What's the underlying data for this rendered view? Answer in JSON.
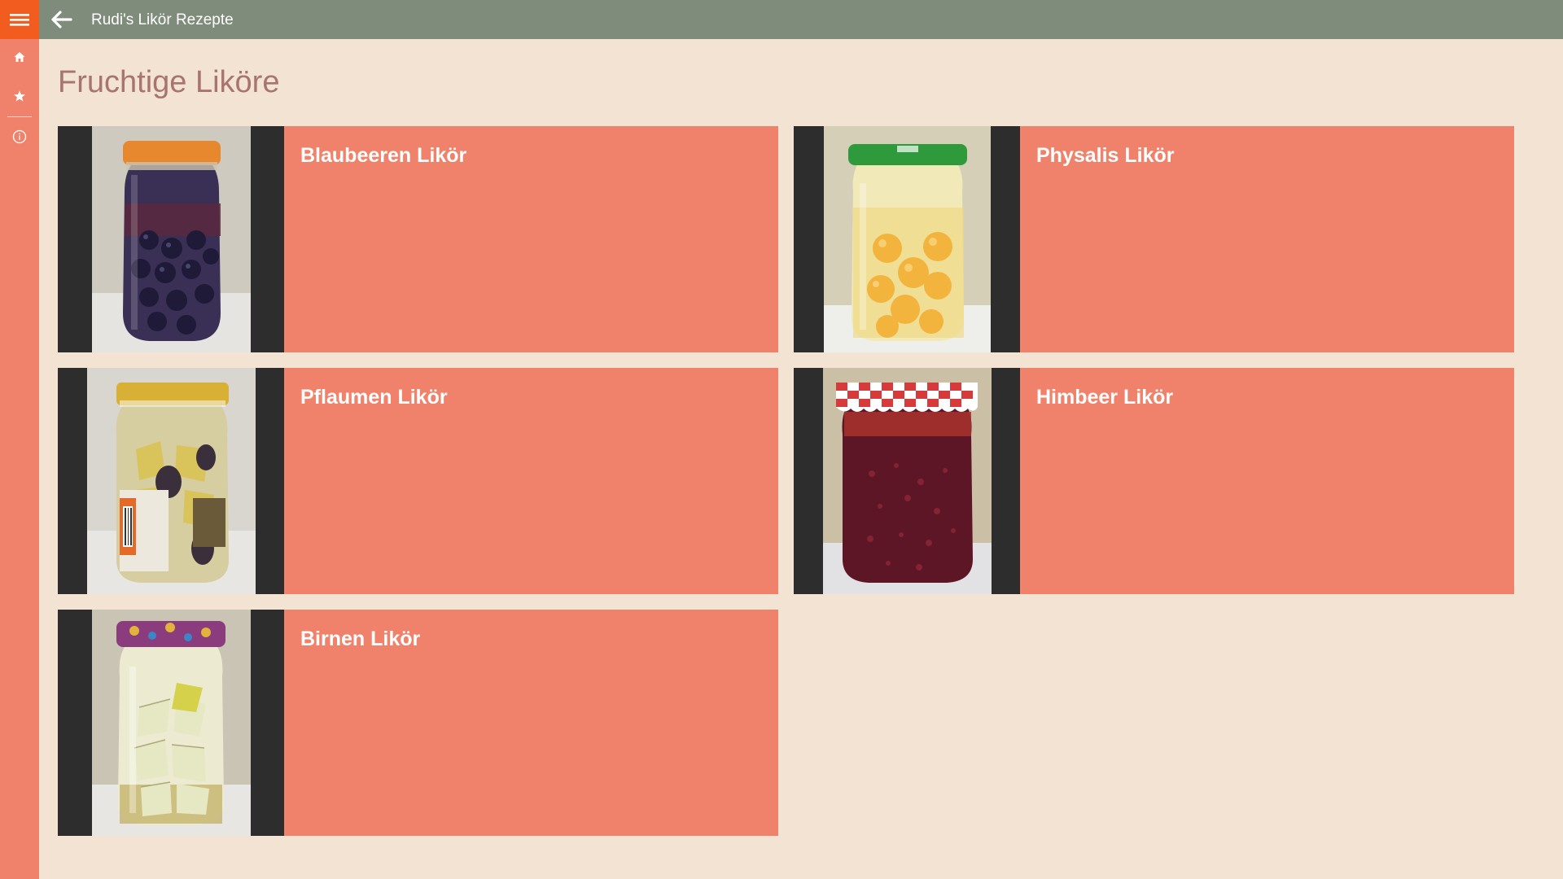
{
  "app": {
    "title": "Rudi's Likör Rezepte"
  },
  "rail": {
    "icons": [
      "hamburger-menu-icon",
      "home-icon",
      "star-icon",
      "info-icon"
    ]
  },
  "page": {
    "title": "Fruchtige Liköre"
  },
  "recipes": [
    {
      "name": "Blaubeeren Likör",
      "image": "jar-blueberries",
      "lid_color": "#e8882e",
      "fill_color": "#2a2444"
    },
    {
      "name": "Physalis Likör",
      "image": "jar-physalis",
      "lid_color": "#2f9a3c",
      "fill_color": "#f2c248"
    },
    {
      "name": "Pflaumen Likör",
      "image": "jar-plums",
      "lid_color": "#d9b036",
      "fill_color": "#c2b373"
    },
    {
      "name": "Himbeer Likör",
      "image": "jar-raspberries",
      "lid_color": "#d03a3a",
      "fill_color": "#5c1626"
    },
    {
      "name": "Birnen Likör",
      "image": "jar-pears",
      "lid_color": "#8a3c7c",
      "fill_color": "#d8d5a0"
    }
  ],
  "colors": {
    "background": "#f2e3d3",
    "rail": "#f0826b",
    "accent": "#f25c1e",
    "titlebar": "#7f8c7b",
    "tile": "#f0826b",
    "heading": "#a77470"
  }
}
